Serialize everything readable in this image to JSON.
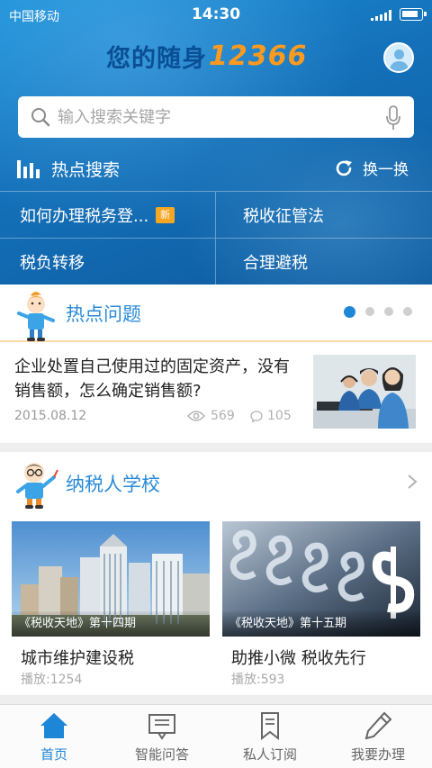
{
  "status_bar": {
    "carrier": "中国移动",
    "time": "14:30"
  },
  "header": {
    "title_cn": "您的随身",
    "title_num": "12366"
  },
  "search": {
    "placeholder": "输入搜索关键字"
  },
  "hot_search": {
    "label": "热点搜索",
    "refresh_label": "换一换",
    "items": [
      {
        "label": "如何办理税务登...",
        "badge": "新"
      },
      {
        "label": "税收征管法"
      },
      {
        "label": "税负转移"
      },
      {
        "label": "合理避税"
      }
    ]
  },
  "hot_questions": {
    "title": "热点问题",
    "carousel_pages": 4,
    "active_page": 1,
    "article": {
      "headline": "企业处置自己使用过的固定资产，没有销售额，怎么确定销售额?",
      "date": "2015.08.12",
      "views": "569",
      "comments": "105"
    }
  },
  "taxpayer_school": {
    "title": "纳税人学校",
    "videos": [
      {
        "episode": "《税收天地》第十四期",
        "title": "城市维护建设税",
        "plays": "播放:1254"
      },
      {
        "episode": "《税收天地》第十五期",
        "title": "助推小微 税收先行",
        "plays": "播放:593"
      }
    ]
  },
  "tabbar": {
    "tabs": [
      {
        "label": "首页",
        "icon": "home-icon",
        "active": true
      },
      {
        "label": "智能问答",
        "icon": "chat-board-icon",
        "active": false
      },
      {
        "label": "私人订阅",
        "icon": "bookmark-icon",
        "active": false
      },
      {
        "label": "我要办理",
        "icon": "pencil-icon",
        "active": false
      }
    ]
  },
  "colors": {
    "accent": "#1e86d6",
    "brand_orange": "#ff9a1f",
    "badge": "#f5a623"
  }
}
